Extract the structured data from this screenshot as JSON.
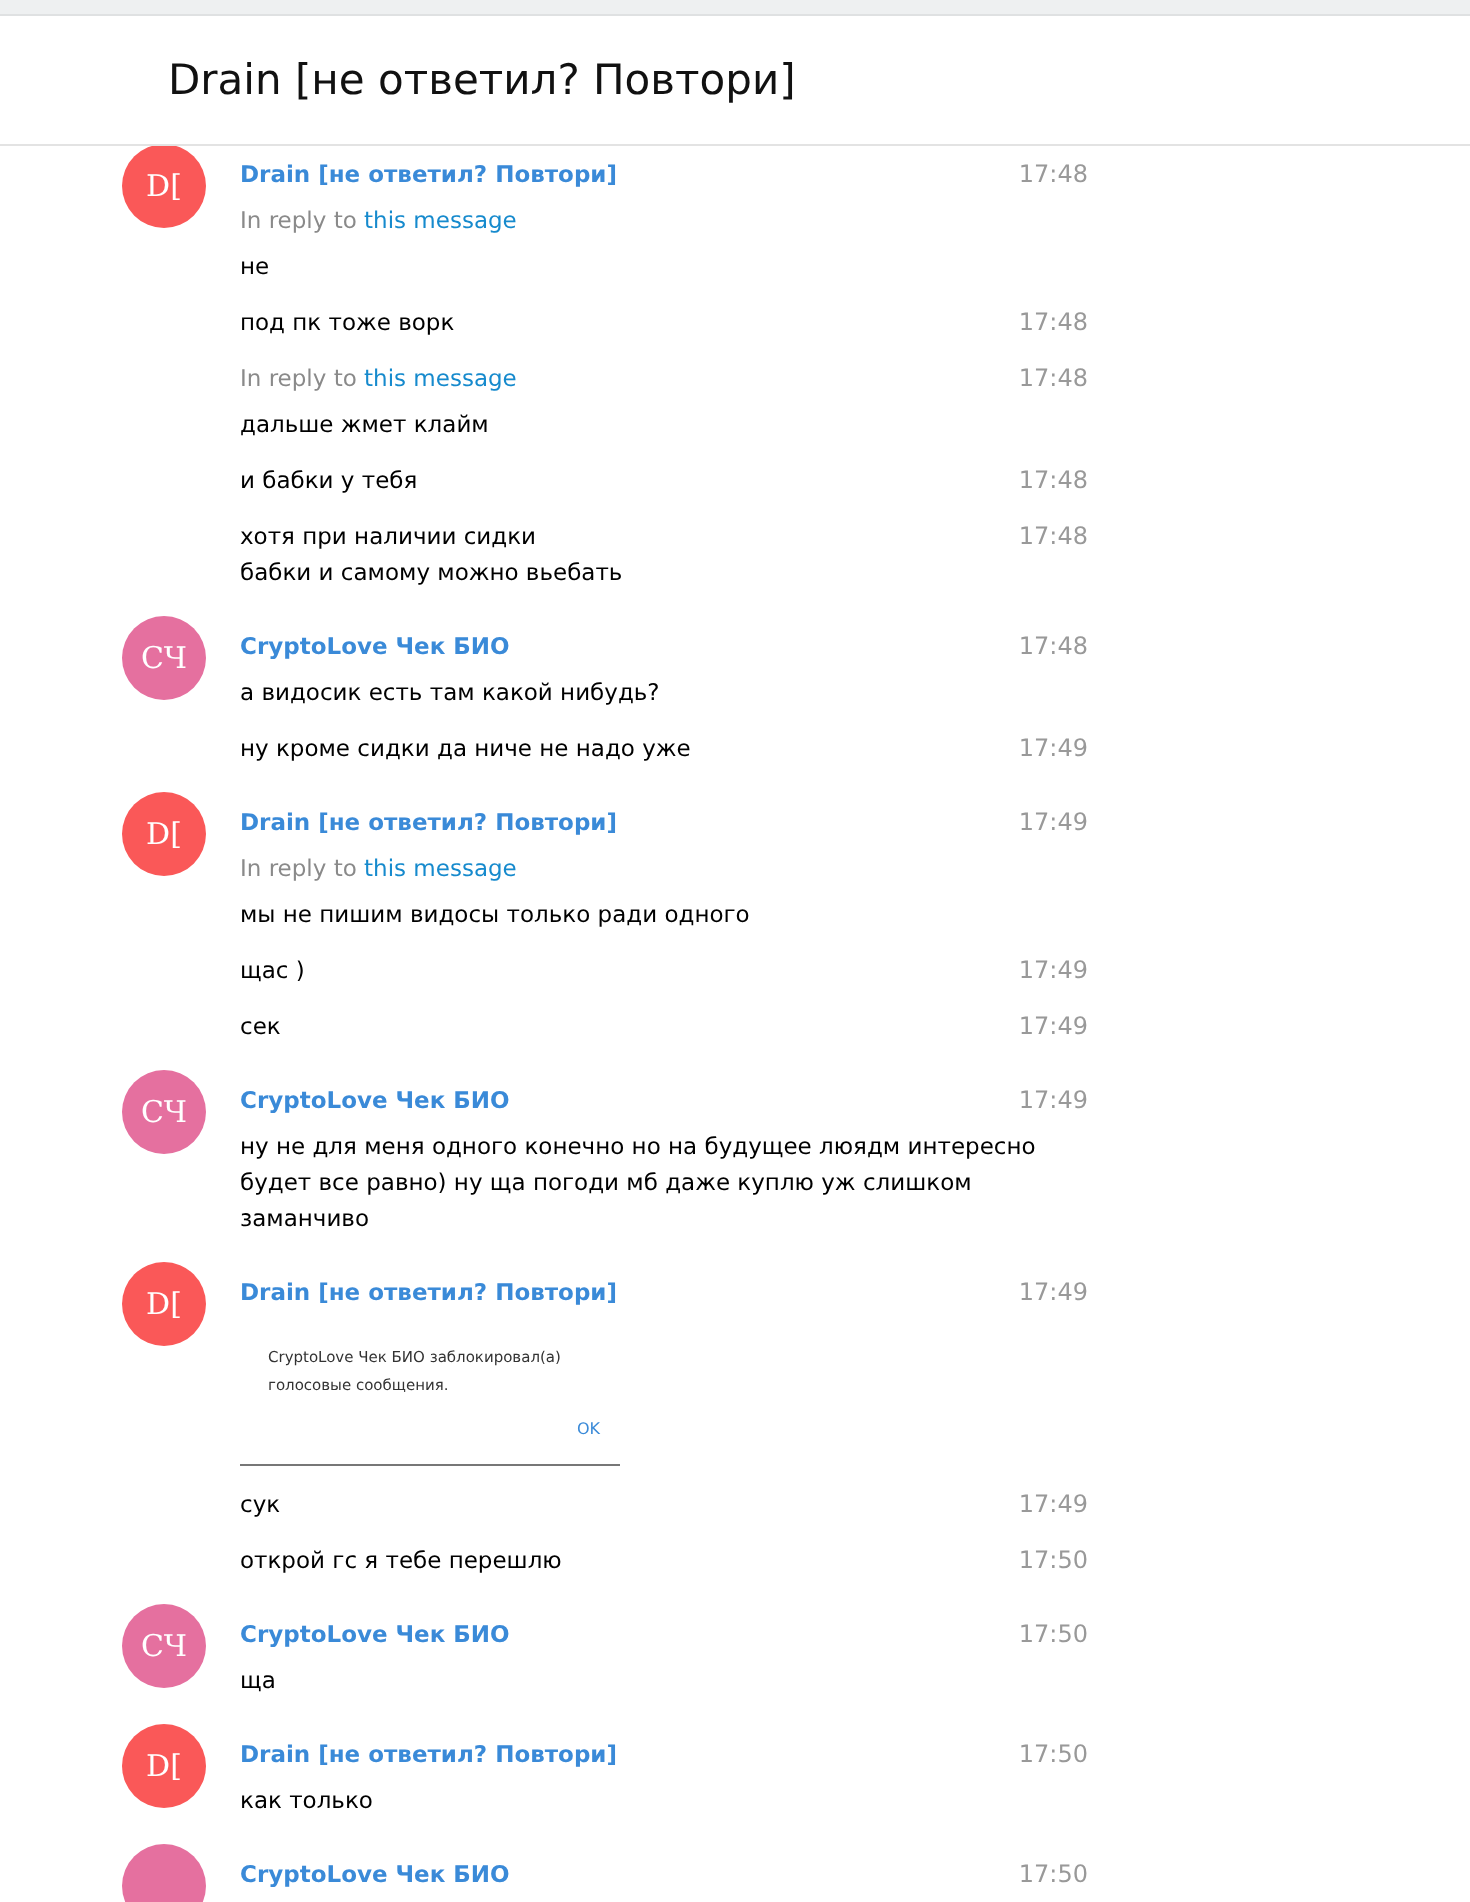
{
  "header": {
    "title": "Drain [не ответил? Повтори]"
  },
  "groups": [
    {
      "sender": {
        "name": "Drain [не ответил? Повтори]",
        "initials": "D[",
        "color": "#fa5858"
      },
      "time": "17:48",
      "entries": [
        {
          "kind": "text",
          "reply": {
            "prefix": "In reply to",
            "link": "this message"
          },
          "text": "не"
        },
        {
          "kind": "text",
          "text": "под пк тоже ворк",
          "time": "17:48"
        },
        {
          "kind": "text",
          "reply": {
            "prefix": "In reply to",
            "link": "this message"
          },
          "text": "дальше жмет клайм",
          "time": "17:48"
        },
        {
          "kind": "text",
          "text": "и бабки у тебя",
          "time": "17:48"
        },
        {
          "kind": "text",
          "text": "хотя при наличии сидки\nбабки и самому можно вьебать",
          "time": "17:48"
        }
      ]
    },
    {
      "sender": {
        "name": "CryptoLove Чек БИО",
        "initials": "СЧ",
        "color": "#e5709f"
      },
      "time": "17:48",
      "entries": [
        {
          "kind": "text",
          "text": "а видосик есть там какой нибудь?"
        },
        {
          "kind": "text",
          "text": "ну кроме сидки да ниче не надо уже",
          "time": "17:49"
        }
      ]
    },
    {
      "sender": {
        "name": "Drain [не ответил? Повтори]",
        "initials": "D[",
        "color": "#fa5858"
      },
      "time": "17:49",
      "entries": [
        {
          "kind": "text",
          "reply": {
            "prefix": "In reply to",
            "link": "this message"
          },
          "text": "мы не пишим видосы только ради одного"
        },
        {
          "kind": "text",
          "text": "щас )",
          "time": "17:49"
        },
        {
          "kind": "text",
          "text": "сек",
          "time": "17:49"
        }
      ]
    },
    {
      "sender": {
        "name": "CryptoLove Чек БИО",
        "initials": "СЧ",
        "color": "#e5709f"
      },
      "time": "17:49",
      "entries": [
        {
          "kind": "text",
          "text": "ну не для меня одного конечно но на будущее люядм интересно будет все равно) ну ща погоди мб даже куплю уж слишком заманчиво"
        }
      ]
    },
    {
      "sender": {
        "name": "Drain [не ответил? Повтори]",
        "initials": "D[",
        "color": "#fa5858"
      },
      "time": "17:49",
      "entries": [
        {
          "kind": "screenshot",
          "text": "CryptoLove Чек БИО заблокировал(а)\nголосовые сообщения.",
          "button": "OK"
        },
        {
          "kind": "text",
          "text": "сук",
          "time": "17:49"
        },
        {
          "kind": "text",
          "text": "открой гс я тебе перешлю",
          "time": "17:50"
        }
      ]
    },
    {
      "sender": {
        "name": "CryptoLove Чек БИО",
        "initials": "СЧ",
        "color": "#e5709f"
      },
      "time": "17:50",
      "entries": [
        {
          "kind": "text",
          "text": "ща"
        }
      ]
    },
    {
      "sender": {
        "name": "Drain [не ответил? Повтори]",
        "initials": "D[",
        "color": "#fa5858"
      },
      "time": "17:50",
      "entries": [
        {
          "kind": "text",
          "text": "как только"
        }
      ]
    },
    {
      "sender": {
        "name": "CryptoLove Чек БИО",
        "color": "#e5709f"
      },
      "time": "17:50"
    }
  ]
}
